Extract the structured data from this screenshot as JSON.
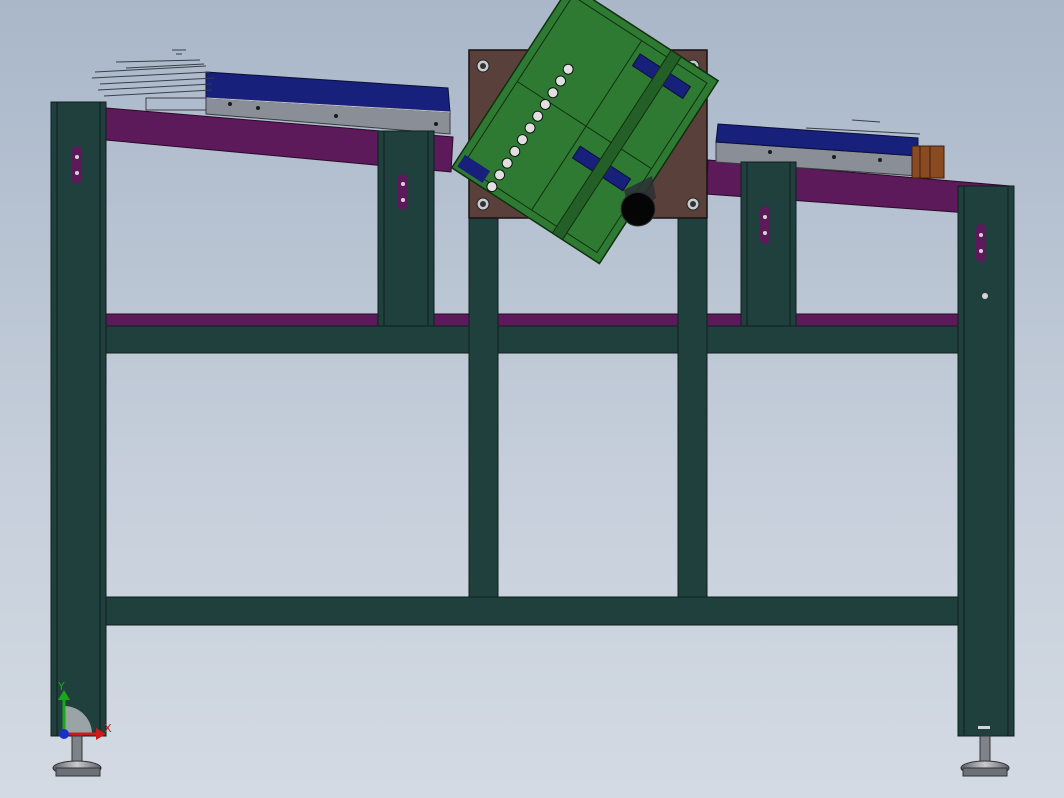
{
  "view": {
    "background_top": "#a9b7c9",
    "background_bottom": "#d3dae3"
  },
  "colors": {
    "frame": "#20403d",
    "frame_edge": "#0f1f1d",
    "rail": "#5c1a5a",
    "plate": "#5a403a",
    "board": "#2f7a32",
    "conveyor_body": "#17207a",
    "conveyor_side": "#8a8f97",
    "bearing": "#8a4a22",
    "terminal": "#7a3a2e"
  },
  "axis_triad": {
    "x_label": "X",
    "y_label": "Y",
    "x_color": "#d01818",
    "y_color": "#18a818",
    "z_color": "#1830c8"
  }
}
